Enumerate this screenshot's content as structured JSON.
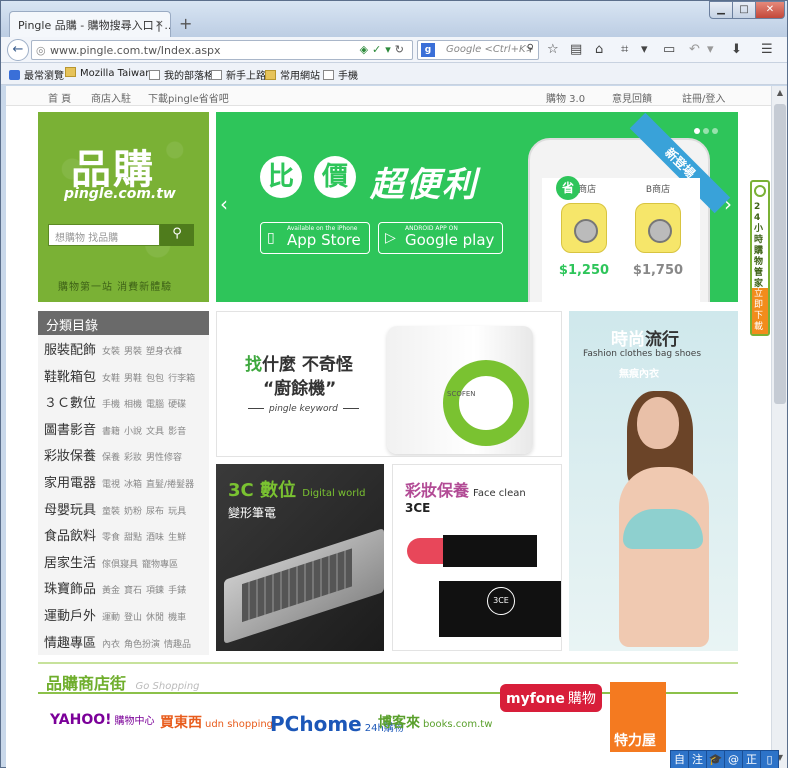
{
  "browser": {
    "tab_title": "Pingle 品購 - 購物搜尋入口 | ...",
    "tab_close": "×",
    "new_tab": "+",
    "url": "www.pingle.com.tw/Index.aspx",
    "search_placeholder": "Google <Ctrl+K>",
    "controls": {
      "minimize": "▁",
      "maximize": "□",
      "close": "✕"
    },
    "bookmarks": [
      "最常瀏覽",
      "Mozilla Taiwan",
      "我的部落格",
      "新手上路",
      "常用網站",
      "手機"
    ]
  },
  "site_nav": {
    "left": [
      "首 頁",
      "商店入駐",
      "下載pingle省省吧"
    ],
    "right": [
      "購物 3.0",
      "意見回饋",
      "註冊/登入"
    ]
  },
  "logo": {
    "main": "品購",
    "sub": "pingle.com.tw",
    "search_placeholder": "想購物 找品購",
    "search_button": "⚲",
    "slogan": "購物第一站 消費新體驗"
  },
  "banner": {
    "bubble1": "比",
    "bubble2": "價",
    "title": "超便利",
    "appstore_small": "Available on the iPhone",
    "appstore": "App Store",
    "googleplay_small": "ANDROID APP ON",
    "googleplay": "Google play",
    "ribbon": "新登場",
    "save_badge": "省",
    "shop_a": "A商店",
    "shop_b": "B商店",
    "price_a": "$1,250",
    "price_b": "$1,750",
    "prev": "‹",
    "next": "›",
    "slide_count": 3,
    "active_slide": 1
  },
  "categories": {
    "title": "分類目錄",
    "items": [
      {
        "main": "服裝配飾",
        "subs": [
          "女裝",
          "男裝",
          "塑身衣褲"
        ]
      },
      {
        "main": "鞋靴箱包",
        "subs": [
          "女鞋",
          "男鞋",
          "包包",
          "行李箱"
        ]
      },
      {
        "main": "３Ｃ數位",
        "subs": [
          "手機",
          "相機",
          "電腦",
          "硬碟"
        ]
      },
      {
        "main": "圖書影音",
        "subs": [
          "書籍",
          "小說",
          "文具",
          "影音"
        ]
      },
      {
        "main": "彩妝保養",
        "subs": [
          "保養",
          "彩妝",
          "男性修容"
        ]
      },
      {
        "main": "家用電器",
        "subs": [
          "電視",
          "冰箱",
          "直髮/捲髮器"
        ]
      },
      {
        "main": "母嬰玩具",
        "subs": [
          "童裝",
          "奶粉",
          "尿布",
          "玩具"
        ]
      },
      {
        "main": "食品飲料",
        "subs": [
          "零食",
          "甜點",
          "酒味",
          "生鮮"
        ]
      },
      {
        "main": "居家生活",
        "subs": [
          "傢俱寢具",
          "寵物專區"
        ]
      },
      {
        "main": "珠寶飾品",
        "subs": [
          "黃金",
          "寶石",
          "項鍊",
          "手錶"
        ]
      },
      {
        "main": "運動戶外",
        "subs": [
          "運動",
          "登山",
          "休閒",
          "機車"
        ]
      },
      {
        "main": "情趣專區",
        "subs": [
          "內衣",
          "角色扮演",
          "情趣品"
        ]
      }
    ]
  },
  "promo_keyword": {
    "line1_green": "找",
    "line1": "什麼  不奇怪",
    "line2": "“廚餘機”",
    "sub": "pingle keyword",
    "brand": "SCOFEN"
  },
  "promo_3c": {
    "title": "3C 數位",
    "title_en": "Digital world",
    "sub": "變形筆電"
  },
  "promo_makeup": {
    "title": "彩妝保養",
    "title_en": "Face clean",
    "sub": "3CE",
    "box_label": "3CE"
  },
  "promo_fashion": {
    "title_white": "時尚",
    "title": "流行",
    "sub": "Fashion clothes bag shoes",
    "sub2": "無痕內衣"
  },
  "shop_street": {
    "title": "品購商店街",
    "subtitle": "Go Shopping",
    "stores": [
      {
        "name": "YAHOO!",
        "extra": "購物中心",
        "color": "#7b0099"
      },
      {
        "name": "買東西",
        "extra": "udn shopping",
        "color": "#e85c1c"
      },
      {
        "name": "PChome",
        "extra": "24h購物",
        "color": "#1c57b8"
      },
      {
        "name": "博客來",
        "extra": "books.com.tw",
        "color": "#5aa02c"
      },
      {
        "name": "myfone",
        "extra": "購物",
        "color": "#d81e3a"
      },
      {
        "name": "特力屋",
        "extra": "",
        "color": "#f47a20"
      }
    ]
  },
  "side_tab": {
    "text": "24小時購物管家",
    "download": "立即下載"
  },
  "ime": [
    "自",
    "注",
    "🎓",
    "@",
    "正",
    "▯"
  ]
}
